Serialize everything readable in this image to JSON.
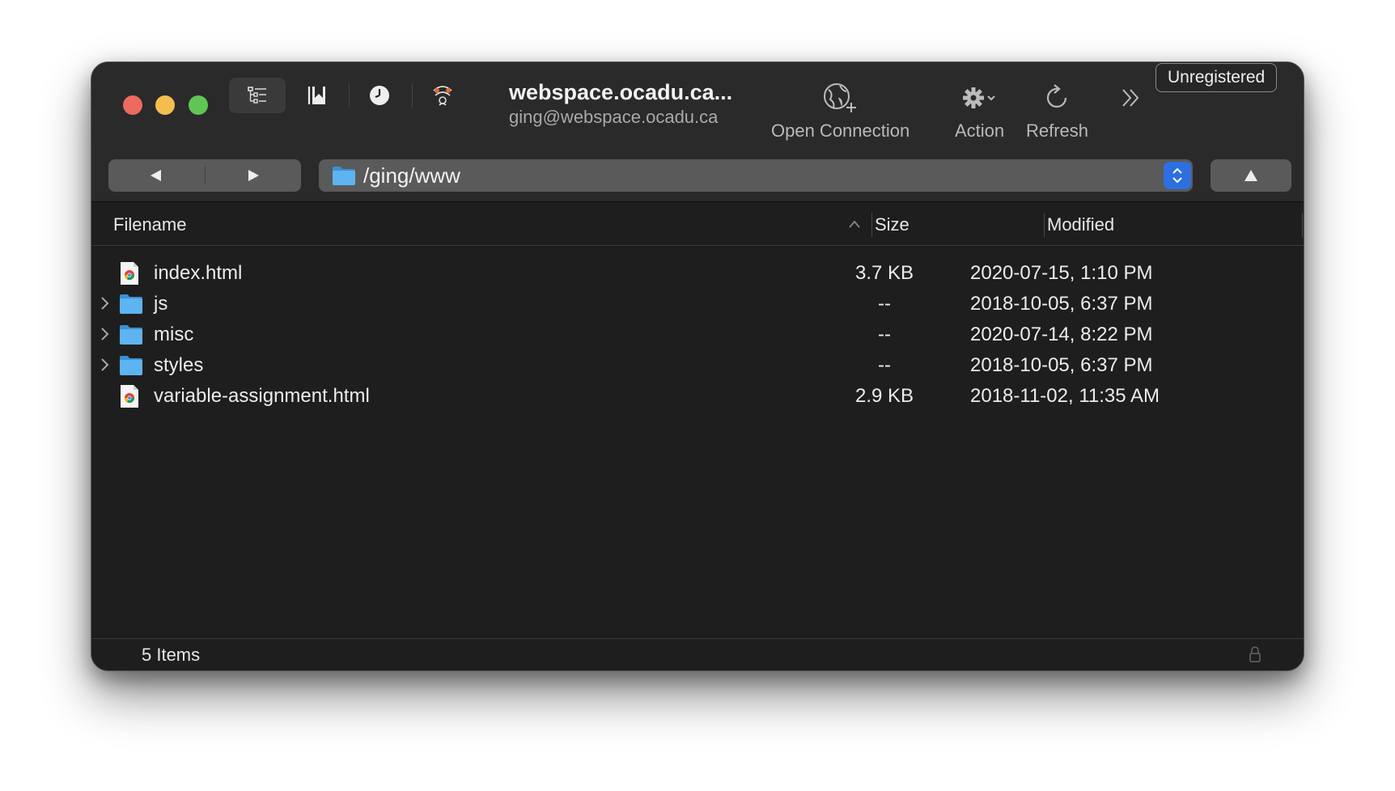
{
  "window": {
    "server_name": "webspace.ocadu.ca...",
    "server_user": "ging@webspace.ocadu.ca",
    "badge": "Unregistered"
  },
  "toolbar": {
    "buttons": [
      {
        "icon": "outline-view-icon"
      },
      {
        "icon": "bookmarks-icon"
      },
      {
        "icon": "history-icon"
      },
      {
        "icon": "bonjour-icon"
      }
    ],
    "open_connection": "Open Connection",
    "action": "Action",
    "refresh": "Refresh"
  },
  "navigation": {
    "path": "/ging/www"
  },
  "columns": {
    "filename": "Filename",
    "size": "Size",
    "modified": "Modified"
  },
  "files": [
    {
      "name": "index.html",
      "type": "html",
      "size": "3.7 KB",
      "modified": "2020-07-15, 1:10 PM"
    },
    {
      "name": "js",
      "type": "folder",
      "size": "--",
      "modified": "2018-10-05, 6:37 PM"
    },
    {
      "name": "misc",
      "type": "folder",
      "size": "--",
      "modified": "2020-07-14, 8:22 PM"
    },
    {
      "name": "styles",
      "type": "folder",
      "size": "--",
      "modified": "2018-10-05, 6:37 PM"
    },
    {
      "name": "variable-assignment.html",
      "type": "html",
      "size": "2.9 KB",
      "modified": "2018-11-02, 11:35 AM"
    }
  ],
  "status": {
    "items_text": "5 Items"
  },
  "colors": {
    "accent": "#2d6fe0",
    "folder": "#4fa8ea",
    "close": "#ed6a5e",
    "minimize": "#f4be4f",
    "maximize": "#61c554"
  }
}
